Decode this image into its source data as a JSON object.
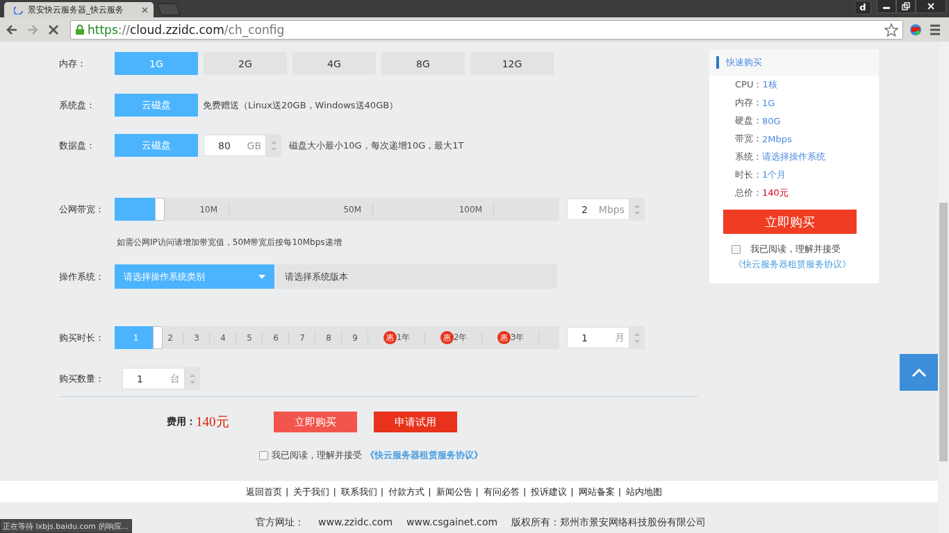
{
  "browser": {
    "tab_title": "景安快云服务器_快云服务",
    "url_scheme": "https",
    "url_rest": "://",
    "url_host": "cloud.zzidc.com",
    "url_path": "/ch_config",
    "profile": "d",
    "loading": true
  },
  "memory": {
    "label": "内存：",
    "options": [
      {
        "label": "1G",
        "selected": true
      },
      {
        "label": "2G",
        "selected": false
      },
      {
        "label": "4G",
        "selected": false
      },
      {
        "label": "8G",
        "selected": false
      },
      {
        "label": "12G",
        "selected": false
      }
    ]
  },
  "system_disk": {
    "label": "系统盘：",
    "type": "云磁盘",
    "note": "免费赠送（Linux送20GB，Windows送40GB）"
  },
  "data_disk": {
    "label": "数据盘：",
    "type": "云磁盘",
    "value": "80",
    "unit": "GB",
    "note": "磁盘大小最小10G，每次递增10G，最大1T"
  },
  "bandwidth": {
    "label": "公网带宽：",
    "level": 0.09,
    "ticks": [
      "10M",
      "50M",
      "100M"
    ],
    "value": "2",
    "unit": "Mbps",
    "hint": "如需公网IP访问请增加带宽值，50M带宽后按每10Mbps递增"
  },
  "os": {
    "label": "操作系统：",
    "category": "请选择操作系统类别",
    "version": "请选择系统版本"
  },
  "duration": {
    "label": "购买时长：",
    "level": 0.086,
    "value": "1",
    "unit": "月",
    "ticks": [
      {
        "label": "1",
        "selected": true
      },
      {
        "label": "2",
        "selected": false
      },
      {
        "label": "3",
        "selected": false
      },
      {
        "label": "4",
        "selected": false
      },
      {
        "label": "5",
        "selected": false
      },
      {
        "label": "6",
        "selected": false
      },
      {
        "label": "7",
        "selected": false
      },
      {
        "label": "8",
        "selected": false
      },
      {
        "label": "9",
        "selected": false
      },
      {
        "label": "1年",
        "selected": false,
        "badge": "惠"
      },
      {
        "label": "2年",
        "selected": false,
        "badge": "惠"
      },
      {
        "label": "3年",
        "selected": false,
        "badge": "惠"
      }
    ]
  },
  "quantity": {
    "label": "购买数量：",
    "value": "1",
    "unit": "台"
  },
  "fee": {
    "label": "费用：",
    "amount": "140元"
  },
  "buttons": [
    {
      "label": "立即购买"
    },
    {
      "label": "申请试用"
    }
  ],
  "agreement": {
    "checked": false,
    "text": "我已阅读，理解并接受",
    "link": "《快云服务器租赁服务协议》"
  },
  "quick_buy": {
    "title": "快速购买",
    "items": [
      {
        "label": "CPU：",
        "value": "1核",
        "kind": "normal"
      },
      {
        "label": "内存：",
        "value": "1G",
        "kind": "normal"
      },
      {
        "label": "硬盘：",
        "value": "80G",
        "kind": "normal"
      },
      {
        "label": "带宽：",
        "value": "2Mbps",
        "kind": "normal"
      },
      {
        "label": "系统：",
        "value": "请选择操作系统",
        "kind": "normal"
      },
      {
        "label": "时长：",
        "value": "1个月",
        "kind": "normal"
      },
      {
        "label": "总价：",
        "value": "140元",
        "kind": "price"
      }
    ],
    "button": "立即购买",
    "agreement": {
      "checked": false,
      "text": "我已阅读，理解并接受",
      "link": "《快云服务器租赁服务协议》"
    }
  },
  "footer": {
    "separator": "|",
    "links": [
      "返回首页",
      "关于我们",
      "联系我们",
      "付款方式",
      "新闻公告",
      "有问必答",
      "投诉建议",
      "网站备案",
      "站内地图"
    ],
    "site_label": "官方网址：",
    "sites": [
      "www.zzidc.com",
      "www.csgainet.com"
    ],
    "copyright": "版权所有：郑州市景安网络科技股份有限公司"
  },
  "status": "正在等待 lxbjs.baidu.com 的响应..."
}
